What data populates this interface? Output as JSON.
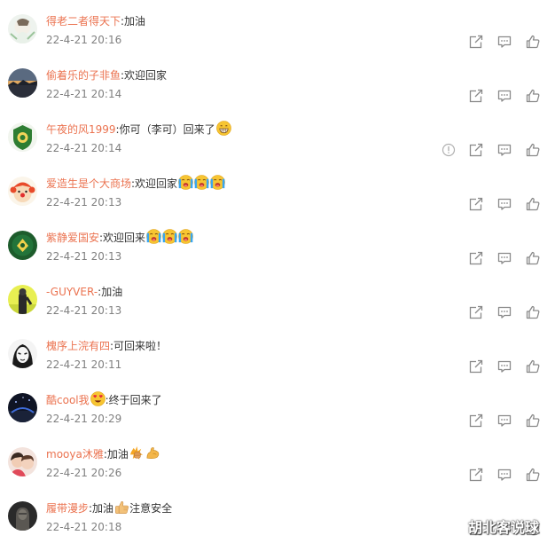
{
  "comments": [
    {
      "username": "得老二者得天下",
      "text": ":加油",
      "emojis": [],
      "time": "22-4-21 20:16",
      "report_icon": false
    },
    {
      "username": "偷着乐的子非鱼",
      "text": ":欢迎回家",
      "emojis": [],
      "time": "22-4-21 20:14",
      "report_icon": false
    },
    {
      "username": "午夜的风1999",
      "text": ":你可（李可）回来了",
      "emojis": [
        "grin-emoji"
      ],
      "time": "22-4-21 20:14",
      "report_icon": true
    },
    {
      "username": "爱造生是个大商场",
      "text": ":欢迎回家",
      "emojis": [
        "cry-emoji",
        "cry-emoji",
        "cry-emoji"
      ],
      "time": "22-4-21 20:13",
      "report_icon": false
    },
    {
      "username": "紫静爱国安",
      "text": ":欢迎回来",
      "emojis": [
        "cry-emoji",
        "cry-emoji",
        "cry-emoji"
      ],
      "time": "22-4-21 20:13",
      "report_icon": false
    },
    {
      "username": "-GUYVER-",
      "text": ":加油",
      "emojis": [],
      "time": "22-4-21 20:13",
      "report_icon": false
    },
    {
      "username": "槐序上浣有四",
      "text": ":可回来啦！",
      "emojis": [],
      "time": "22-4-21 20:11",
      "report_icon": false
    },
    {
      "username": "酷cool我",
      "text": ":终于回来了",
      "emojis": [
        "heart-eyes-emoji"
      ],
      "emoji_position": "before_colon",
      "time": "22-4-21 20:29",
      "report_icon": false
    },
    {
      "username": "mooya沐雅",
      "text": ":加油",
      "emojis": [
        "fist-emoji",
        "muscle-emoji"
      ],
      "time": "22-4-21 20:26",
      "report_icon": false
    },
    {
      "username": "履带漫步",
      "text": ":加油",
      "emojis": [
        "thumbs-up-emoji"
      ],
      "text_after": "注意安全",
      "time": "22-4-21 20:18",
      "report_icon": false
    }
  ],
  "watermark": "胡北客说球",
  "colors": {
    "username": "#eb7350",
    "text": "#333333",
    "time": "#808080",
    "icon": "#8a8a8a"
  },
  "icons": {
    "share": "share-icon",
    "reply": "comment-icon",
    "like": "like-icon",
    "report": "report-icon"
  }
}
